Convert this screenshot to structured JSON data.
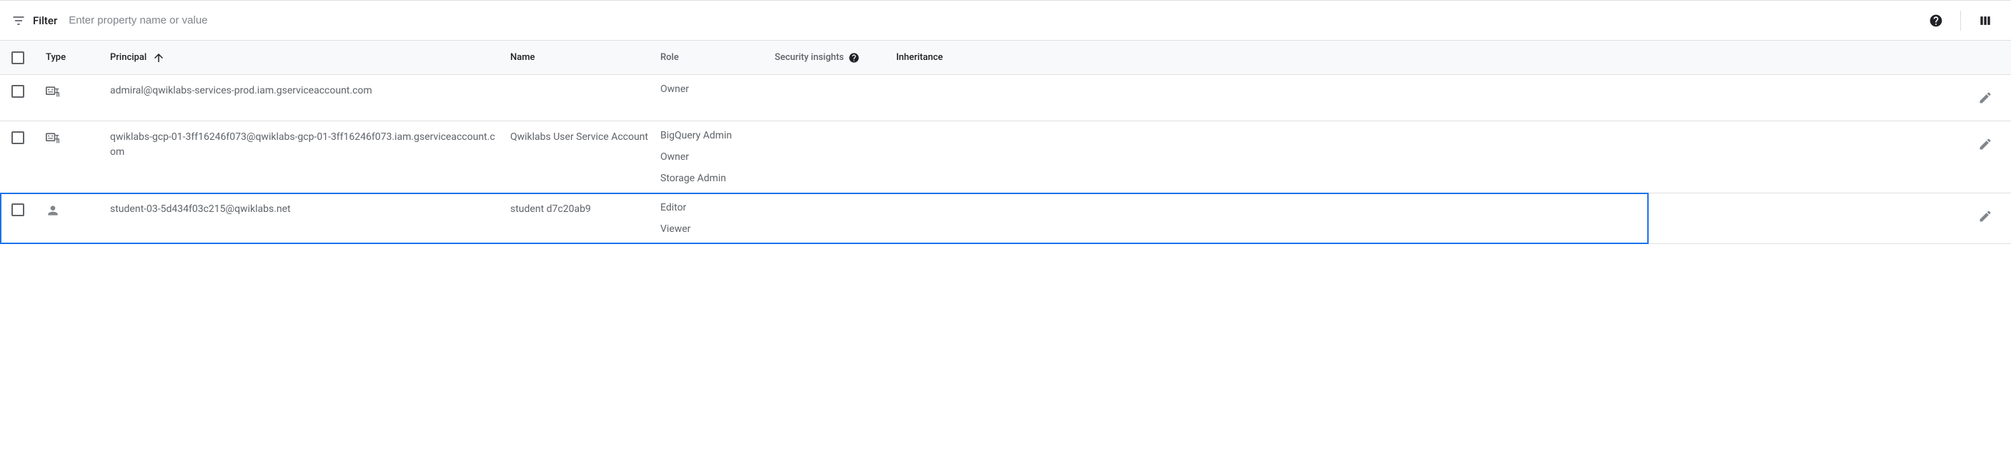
{
  "filter": {
    "label": "Filter",
    "placeholder": "Enter property name or value"
  },
  "columns": {
    "type": "Type",
    "principal": "Principal",
    "name": "Name",
    "role": "Role",
    "security": "Security insights",
    "inheritance": "Inheritance"
  },
  "rows": [
    {
      "type": "service",
      "principal": "admiral@qwiklabs-services-prod.iam.gserviceaccount.com",
      "name": "",
      "roles": [
        "Owner"
      ]
    },
    {
      "type": "service",
      "principal": "qwiklabs-gcp-01-3ff16246f073@qwiklabs-gcp-01-3ff16246f073.iam.gserviceaccount.com",
      "name": "Qwiklabs User Service Account",
      "roles": [
        "BigQuery Admin",
        "Owner",
        "Storage Admin"
      ]
    },
    {
      "type": "user",
      "principal": "student-03-5d434f03c215@qwiklabs.net",
      "name": "student d7c20ab9",
      "roles": [
        "Editor",
        "Viewer"
      ],
      "highlighted": true
    }
  ]
}
